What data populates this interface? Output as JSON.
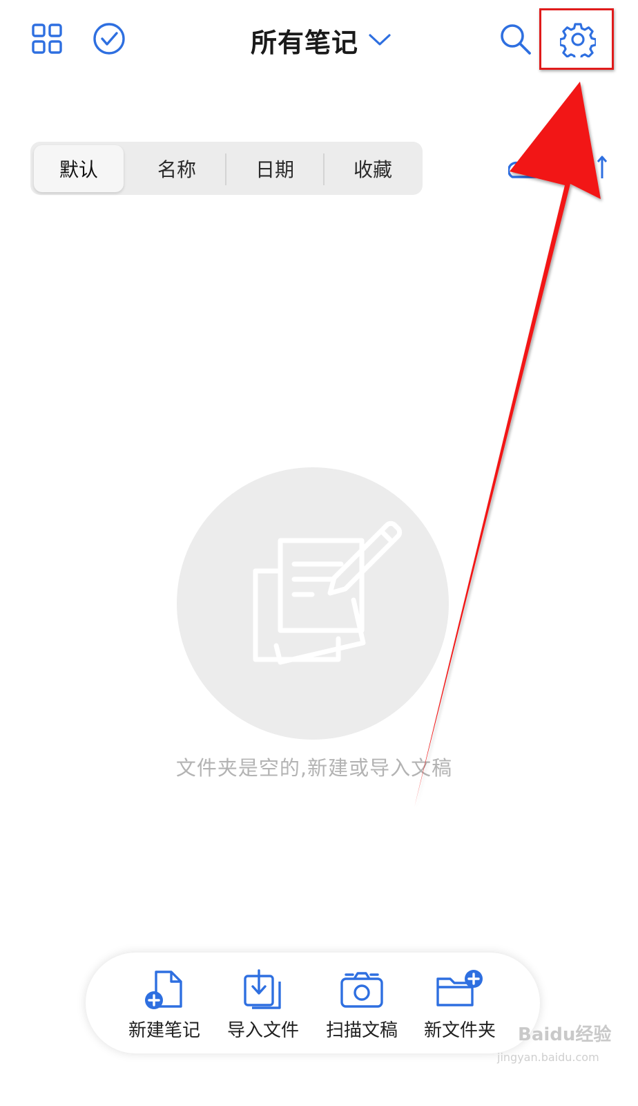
{
  "header": {
    "title": "所有笔记",
    "left_icons": [
      "grid-icon",
      "check-circle-icon"
    ],
    "right_icons": [
      "search-icon",
      "gear-icon"
    ]
  },
  "sort_tabs": {
    "items": [
      "默认",
      "名称",
      "日期",
      "收藏"
    ],
    "selected": "默认"
  },
  "empty_state": {
    "message": "文件夹是空的,新建或导入文稿"
  },
  "bottom_actions": [
    {
      "label": "新建笔记",
      "icon": "new-note-icon"
    },
    {
      "label": "导入文件",
      "icon": "import-file-icon"
    },
    {
      "label": "扫描文稿",
      "icon": "camera-scan-icon"
    },
    {
      "label": "新文件夹",
      "icon": "new-folder-icon"
    }
  ],
  "watermark": {
    "brand": "Baidu经验",
    "url": "jingyan.baidu.com"
  },
  "colors": {
    "accent": "#2e6fe0",
    "annotation_red": "#e01b1b",
    "segment_bg": "#ececec",
    "empty_circle": "#ececec",
    "empty_text": "#b3b3b3"
  }
}
